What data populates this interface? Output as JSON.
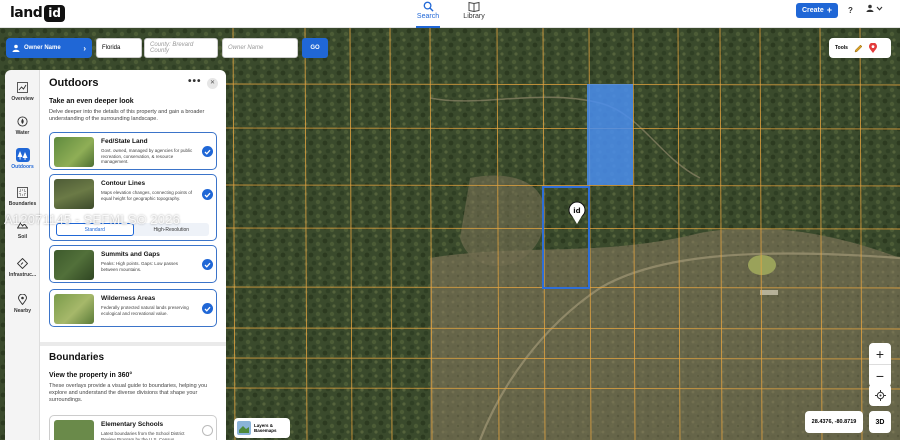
{
  "app": {
    "logo_word": "land",
    "logo_badge": "id"
  },
  "nav": {
    "search_label": "Search",
    "library_label": "Library"
  },
  "header": {
    "create_label": "Create",
    "help_label": "?"
  },
  "search": {
    "owner_button": "Owner Name",
    "state_value": "Florida",
    "county_placeholder": "County: Brevard County",
    "owner_placeholder": "Owner Name",
    "go_label": "GO"
  },
  "tools": {
    "label": "Tools"
  },
  "rail": {
    "items": [
      {
        "label": "Overview",
        "icon": "chart-icon"
      },
      {
        "label": "Water",
        "icon": "water-icon"
      },
      {
        "label": "Outdoors",
        "icon": "outdoors-icon",
        "active": true
      },
      {
        "label": "Boundaries",
        "icon": "boundaries-icon"
      },
      {
        "label": "Soil",
        "icon": "soil-icon"
      },
      {
        "label": "Infrastruc...",
        "icon": "infrastructure-icon"
      },
      {
        "label": "Nearby",
        "icon": "nearby-icon"
      }
    ]
  },
  "panel": {
    "title": "Outdoors",
    "more": "•••",
    "close": "✕",
    "subtitle": "Take an even deeper look",
    "description": "Delve deeper into the details of this property and gain a broader understanding of the surrounding landscape.",
    "cards": [
      {
        "title": "Fed/State Land",
        "desc": "Govt. owned, managed by agencies for public recreation, conservation, & resource management.",
        "checked": true
      },
      {
        "title": "Contour Lines",
        "desc": "Maps elevation changes, connecting points of equal height for geographic topography.",
        "checked": true
      },
      {
        "title": "Summits and Gaps",
        "desc": "Peaks: High points. Gaps: Low passes between mountains.",
        "checked": true
      },
      {
        "title": "Wilderness Areas",
        "desc": "Federally protected natural lands preserving ecological and recreational value.",
        "checked": true
      }
    ],
    "contour_options": {
      "standard": "Standard",
      "high_res": "High-Resolution",
      "selected": "Standard"
    },
    "boundaries_title": "Boundaries",
    "boundaries_subtitle": "View the property in 360°",
    "boundaries_desc": "These overlays provide a visual guide to boundaries, helping you explore and understand the diverse divisions that shape your surroundings.",
    "boundary_card": {
      "title": "Elementary Schools",
      "desc": "Latest boundaries from the School District Review Program by the U.S. Census.",
      "checked": false
    }
  },
  "map": {
    "layers_label_1": "Layers &",
    "layers_label_2": "Basemaps",
    "zoom_in": "+",
    "zoom_out": "−",
    "coords": "28.4376, -80.8719",
    "three_d": "3D",
    "parcel_marker": "id",
    "parcel_line_color": "#e8a640",
    "selected_color": "#2f6fd8",
    "highlight_color": "#4a8ef0"
  },
  "watermark": "A12071145 - SEFMLS© 2026"
}
